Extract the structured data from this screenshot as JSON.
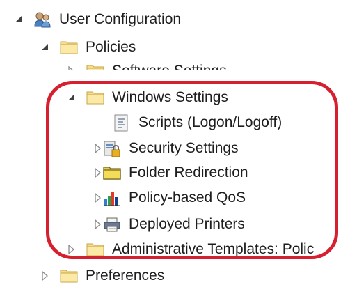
{
  "tree": {
    "user_configuration": {
      "label": "User Configuration",
      "state": "expanded"
    },
    "policies": {
      "label": "Policies",
      "state": "expanded"
    },
    "software_settings": {
      "label": "Software Settings",
      "state": "collapsed"
    },
    "windows_settings": {
      "label": "Windows Settings",
      "state": "expanded"
    },
    "scripts": {
      "label": "Scripts (Logon/Logoff)"
    },
    "security_settings": {
      "label": "Security Settings",
      "state": "collapsed"
    },
    "folder_redirection": {
      "label": "Folder Redirection",
      "state": "collapsed"
    },
    "policy_qos": {
      "label": "Policy-based QoS",
      "state": "collapsed"
    },
    "deployed_printers": {
      "label": "Deployed Printers",
      "state": "collapsed"
    },
    "admin_templates": {
      "label": "Administrative Templates: Polic",
      "state": "collapsed"
    },
    "preferences": {
      "label": "Preferences",
      "state": "collapsed"
    }
  },
  "annotation": {
    "color": "#d6202f"
  }
}
